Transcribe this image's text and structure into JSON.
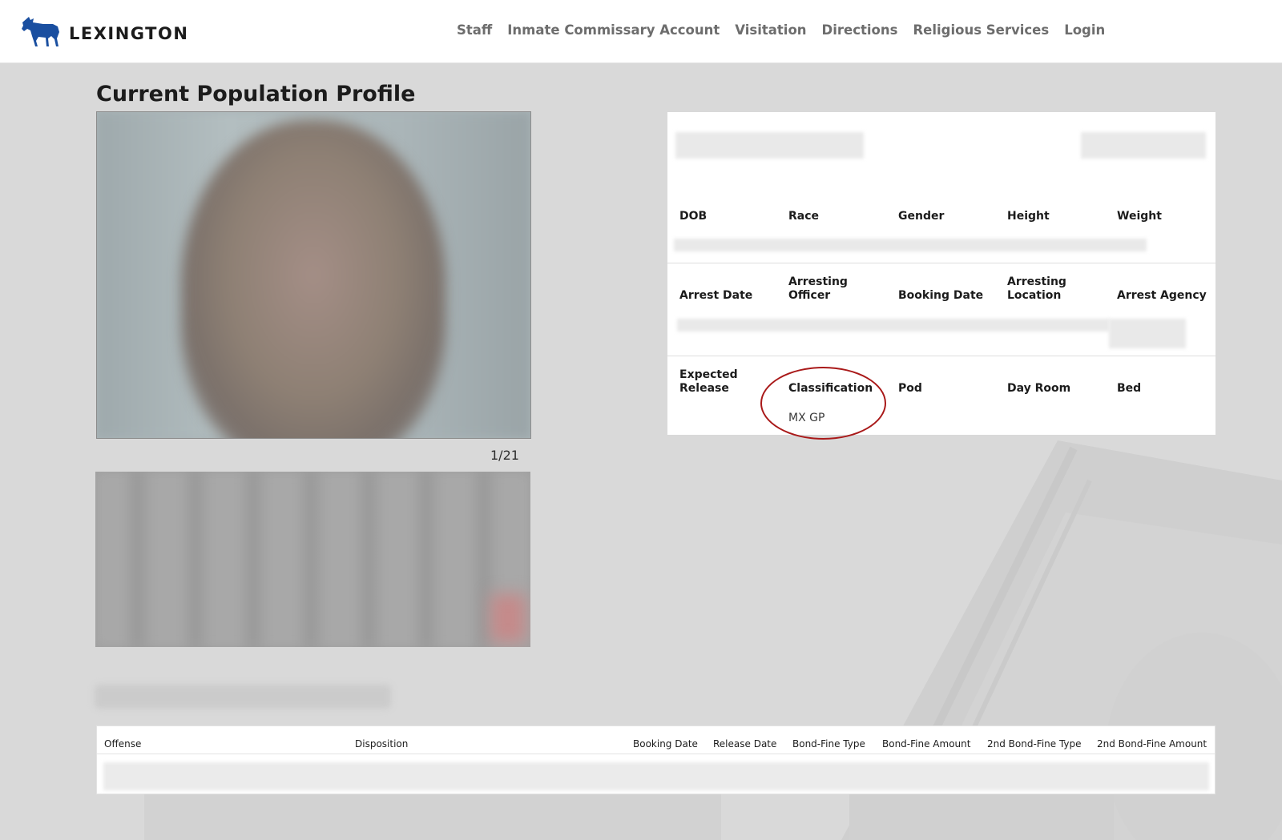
{
  "brand": {
    "name": "LEXINGTON",
    "logo_icon": "horse-icon",
    "logo_color": "#1a4fa0"
  },
  "nav": {
    "items": [
      "Staff",
      "Inmate Commissary Account",
      "Visitation",
      "Directions",
      "Religious Services",
      "Login"
    ]
  },
  "page": {
    "title": "Current Population Profile",
    "photo_counter": "1/21"
  },
  "profile": {
    "row1_headers": [
      "DOB",
      "Race",
      "Gender",
      "Height",
      "Weight"
    ],
    "row2_headers": [
      "Arrest Date",
      "Arresting Officer",
      "Booking Date",
      "Arresting Location",
      "Arrest Agency"
    ],
    "row3_headers": [
      "Expected Release",
      "Classification",
      "Pod",
      "Day Room",
      "Bed"
    ],
    "classification_value": "MX GP",
    "highlight_color": "#a91919"
  },
  "offenses": {
    "headers": [
      "Offense",
      "Disposition",
      "Booking Date",
      "Release Date",
      "Bond-Fine Type",
      "Bond-Fine Amount",
      "2nd Bond-Fine Type",
      "2nd Bond-Fine Amount"
    ]
  }
}
